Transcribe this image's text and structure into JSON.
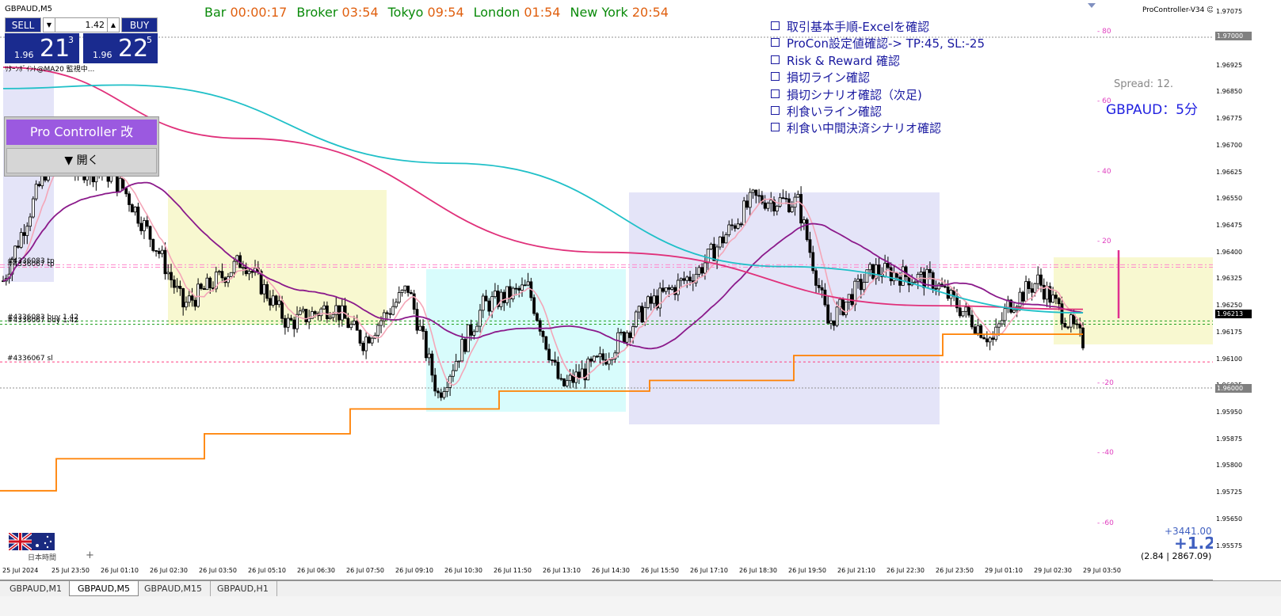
{
  "chart": {
    "symbol_title": "GBPAUD,M5",
    "indicator_caption": "ﾘﾀｰﾝﾎﾞｲﾝﾄ@MA20 監視中...",
    "version_label": "ProController-V34 ☺",
    "spread_label": "Spread: 12.",
    "pair_timeframe": "GBPAUD：5分"
  },
  "clock_bar": [
    {
      "label": "Bar",
      "value": "00:00:17"
    },
    {
      "label": "Broker",
      "value": "03:54"
    },
    {
      "label": "Tokyo",
      "value": "09:54"
    },
    {
      "label": "London",
      "value": "01:54"
    },
    {
      "label": "New York",
      "value": "20:54"
    }
  ],
  "trade_panel": {
    "sell_label": "SELL",
    "buy_label": "BUY",
    "lot_value": "1.42",
    "sell_quote": {
      "prefix": "1.96",
      "big": "21",
      "sup": "3"
    },
    "buy_quote": {
      "prefix": "1.96",
      "big": "22",
      "sup": "5"
    }
  },
  "pro_controller": {
    "title": "Pro Controller 改",
    "open_label": "▼ 開く"
  },
  "checklist": [
    "取引基本手順-Excelを確認",
    "ProCon設定値確認-> TP:45, SL:-25",
    "Risk & Reward 確認",
    "損切ライン確認",
    "損切シナリオ確認（次足)",
    "利食いライン確認",
    "利食い中間決済シナリオ確認"
  ],
  "orders": [
    {
      "label": "#4336083 tp",
      "price": 1.96365
    },
    {
      "label": "#4336067 tp",
      "price": 1.96358
    },
    {
      "label": "#4336083 buy 1.42",
      "price": 1.96207
    },
    {
      "label": "#4336067 buy 1.42",
      "price": 1.96198
    },
    {
      "label": "#4336067 sl",
      "price": 1.96092
    }
  ],
  "profit": {
    "amount": "+3441.00",
    "pips": "+1.2",
    "detail": "(2.84 | 2867.09)"
  },
  "footer": {
    "timezone_label": "日本時間",
    "plus_symbol": "+"
  },
  "price_axis": {
    "ticks": [
      "1.97075",
      "1.97000",
      "1.96925",
      "1.96850",
      "1.96775",
      "1.96700",
      "1.96625",
      "1.96550",
      "1.96475",
      "1.96400",
      "1.96325",
      "1.96250",
      "1.96175",
      "1.96100",
      "1.96025",
      "1.95950",
      "1.95875",
      "1.95800",
      "1.95725",
      "1.95650",
      "1.95575"
    ],
    "current_tag": "1.96213",
    "upper_tag": "1.97000",
    "lower_tag": "1.96000"
  },
  "pips_axis": [
    "80",
    "60",
    "40",
    "20",
    "-20",
    "-40",
    "-60"
  ],
  "time_axis": [
    "25 Jul 2024",
    "25 Jul 23:50",
    "26 Jul 01:10",
    "26 Jul 02:30",
    "26 Jul 03:50",
    "26 Jul 05:10",
    "26 Jul 06:30",
    "26 Jul 07:50",
    "26 Jul 09:10",
    "26 Jul 10:30",
    "26 Jul 11:50",
    "26 Jul 13:10",
    "26 Jul 14:30",
    "26 Jul 15:50",
    "26 Jul 17:10",
    "26 Jul 18:30",
    "26 Jul 19:50",
    "26 Jul 21:10",
    "26 Jul 22:30",
    "26 Jul 23:50",
    "29 Jul 01:10",
    "29 Jul 02:30",
    "29 Jul 03:50"
  ],
  "tabs": [
    {
      "label": "GBPAUD,M1",
      "active": false
    },
    {
      "label": "GBPAUD,M5",
      "active": true
    },
    {
      "label": "GBPAUD,M15",
      "active": false
    },
    {
      "label": "GBPAUD,H1",
      "active": false
    }
  ],
  "chart_data": {
    "type": "candlestick",
    "ylim": [
      1.95525,
      1.971
    ],
    "bars": 227,
    "series": [
      {
        "role": "price",
        "color": "#000000"
      },
      {
        "role": "ma-short",
        "color": "#f4a6b8"
      },
      {
        "role": "ma-mid",
        "color": "#8b1a8b"
      },
      {
        "role": "ma-long",
        "color": "#e0307a"
      },
      {
        "role": "ma-longest",
        "color": "#20c0c8"
      },
      {
        "role": "trailing-stop",
        "color": "#ff8000"
      }
    ],
    "colors": {
      "session_yellow": "#f8f8d0",
      "session_cyan": "#d8fcfc",
      "session_lavender": "#e4e4f8",
      "tp_line": "#ff88cc",
      "buy_line": "#20a020",
      "sl_line": "#ff4080"
    }
  }
}
